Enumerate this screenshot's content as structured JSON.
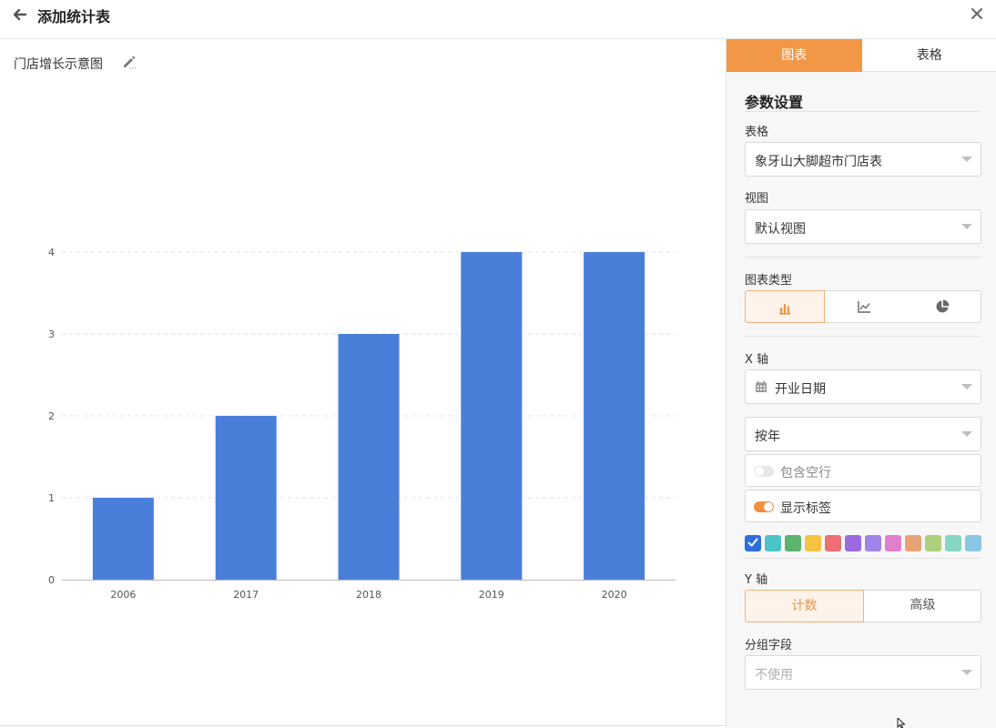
{
  "window": {
    "title": "添加统计表"
  },
  "chart_title": "门店增长示意图",
  "tabs": [
    {
      "label": "图表"
    },
    {
      "label": "表格"
    }
  ],
  "panel": {
    "section_title": "参数设置",
    "table_label": "表格",
    "table_value": "象牙山大脚超市门店表",
    "view_label": "视图",
    "view_value": "默认视图",
    "chart_type_label": "图表类型",
    "chart_type_options": [
      "bar-chart-icon",
      "line-chart-icon",
      "pie-chart-icon"
    ],
    "chart_type_selected": "bar-chart-icon",
    "x_axis_label": "X 轴",
    "x_field_icon": "calendar-icon",
    "x_field_value": "开业日期",
    "x_group_value": "按年",
    "include_empty_label": "包含空行",
    "include_empty_on": false,
    "show_labels_label": "显示标签",
    "show_labels_on": true,
    "color_swatches": [
      "#2e6de0",
      "#4cc3c9",
      "#5ab36e",
      "#f5c242",
      "#ee6e73",
      "#9b6ae0",
      "#a184ea",
      "#e07fd0",
      "#e9a272",
      "#acd07c",
      "#85d6c3",
      "#87c9e4"
    ],
    "selected_color": "#2e6de0",
    "y_axis_label": "Y 轴",
    "y_mode_count": "计数",
    "y_mode_advanced": "高级",
    "group_field_label": "分组字段",
    "group_field_placeholder": "不使用"
  },
  "chart_data": {
    "type": "bar",
    "title": "",
    "xlabel": "",
    "ylabel": "",
    "categories": [
      "2006",
      "2017",
      "2018",
      "2019",
      "2020"
    ],
    "values": [
      1,
      2,
      3,
      4,
      4
    ],
    "ylim": [
      0,
      4
    ],
    "yticks": [
      "0",
      "1",
      "2",
      "3",
      "4"
    ],
    "bar_color": "#4a7fd9",
    "grid": true
  }
}
